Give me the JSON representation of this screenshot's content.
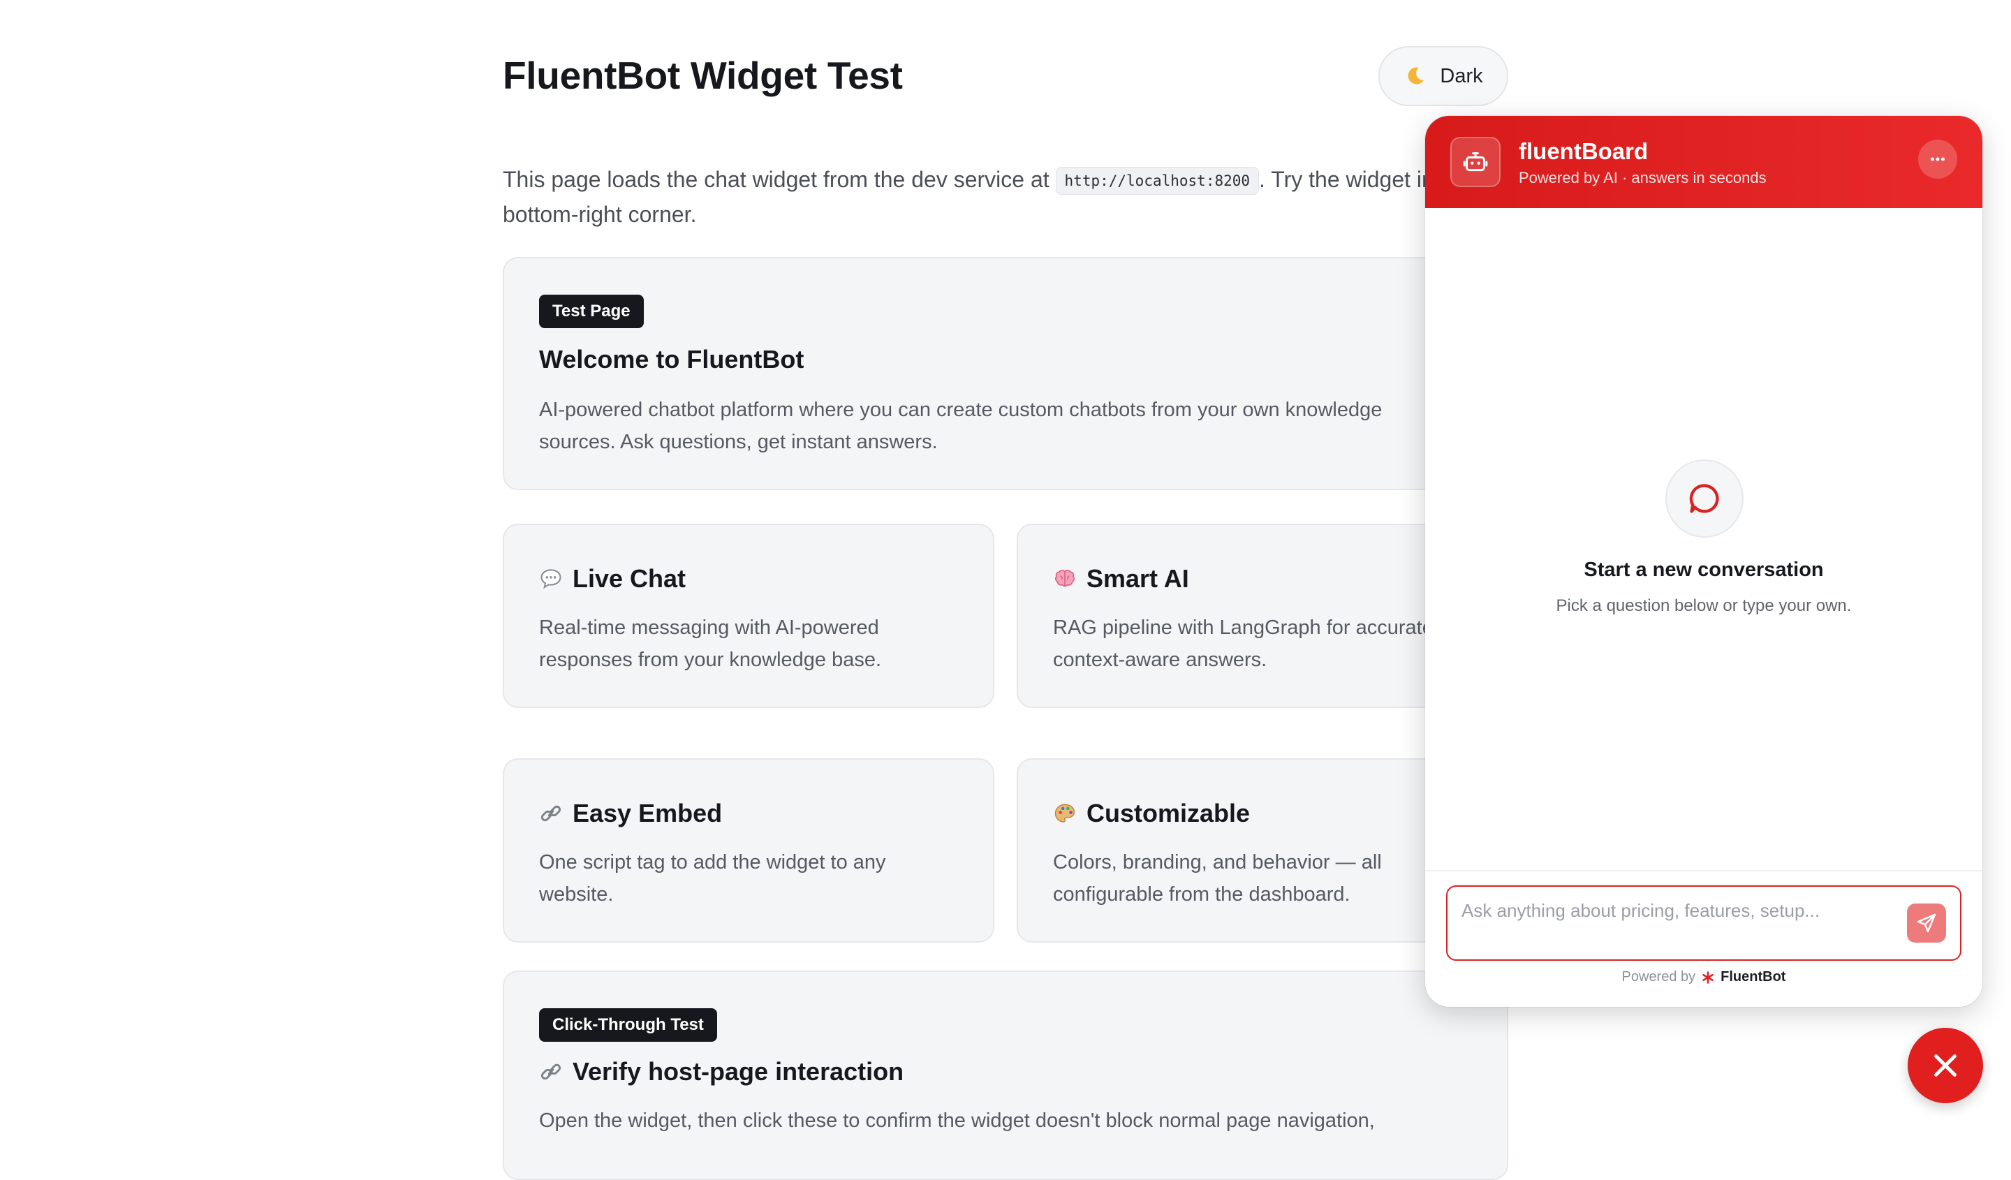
{
  "header": {
    "title": "FluentBot Widget Test",
    "dark_toggle_label": "Dark",
    "dark_toggle_icon": "moon-icon"
  },
  "intro": {
    "before": "This page loads the chat widget from the dev service at ",
    "code": "http://localhost:8200",
    "after": ". Try the widget in the bottom-right corner."
  },
  "welcome_card": {
    "badge": "Test Page",
    "title": "Welcome to FluentBot",
    "description": "AI-powered chatbot platform where you can create custom chatbots from your own knowledge sources. Ask questions, get instant answers."
  },
  "features": [
    {
      "icon": "speech-balloon-icon",
      "title": "Live Chat",
      "description": "Real-time messaging with AI-powered responses from your knowledge base."
    },
    {
      "icon": "brain-icon",
      "title": "Smart AI",
      "description": "RAG pipeline with LangGraph for accurate, context-aware answers."
    },
    {
      "icon": "link-icon",
      "title": "Easy Embed",
      "description": "One script tag to add the widget to any website."
    },
    {
      "icon": "palette-icon",
      "title": "Customizable",
      "description": "Colors, branding, and behavior — all configurable from the dashboard."
    }
  ],
  "click_through_card": {
    "badge": "Click-Through Test",
    "title": "Verify host-page interaction",
    "description": "Open the widget, then click these to confirm the widget doesn't block normal page navigation,"
  },
  "widget": {
    "name": "fluentBoard",
    "subtitle": "Powered by AI · answers in seconds",
    "empty_title": "Start a new conversation",
    "empty_subtitle": "Pick a question below or type your own.",
    "input_placeholder": "Ask anything about pricing, features, setup...",
    "footer_prefix": "Powered by",
    "footer_brand": "FluentBot",
    "accent_color": "#e21f1f"
  }
}
